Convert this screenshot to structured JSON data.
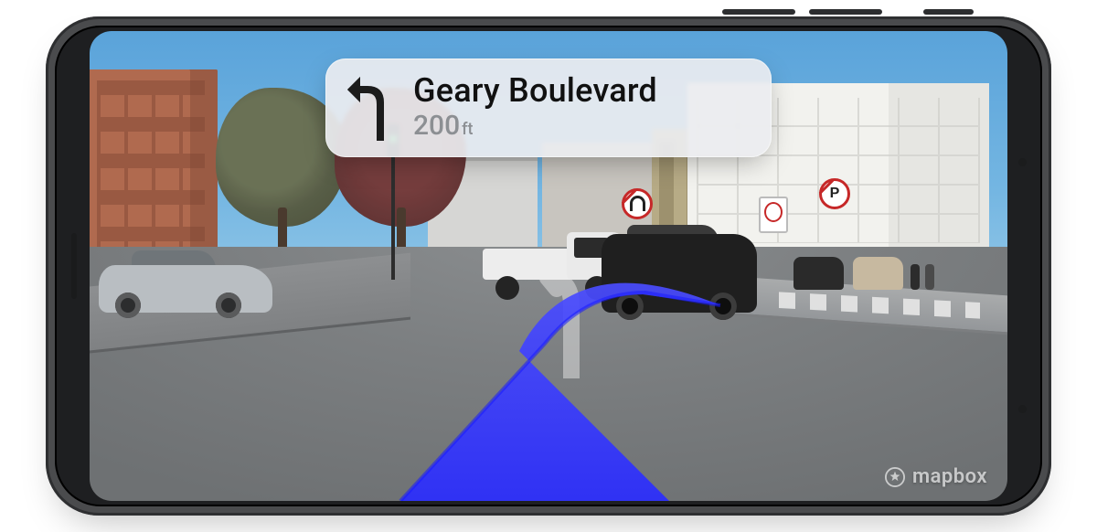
{
  "navigation": {
    "maneuver": "turn-left",
    "street": "Geary Boulevard",
    "distance_value": "200",
    "distance_unit": "ft"
  },
  "ar_path": {
    "color": "#2a2cff"
  },
  "watermark": {
    "brand": "mapbox"
  },
  "icons": {
    "turn_left": "turn-left-arrow-icon",
    "brand_logo": "mapbox-logo-icon"
  }
}
